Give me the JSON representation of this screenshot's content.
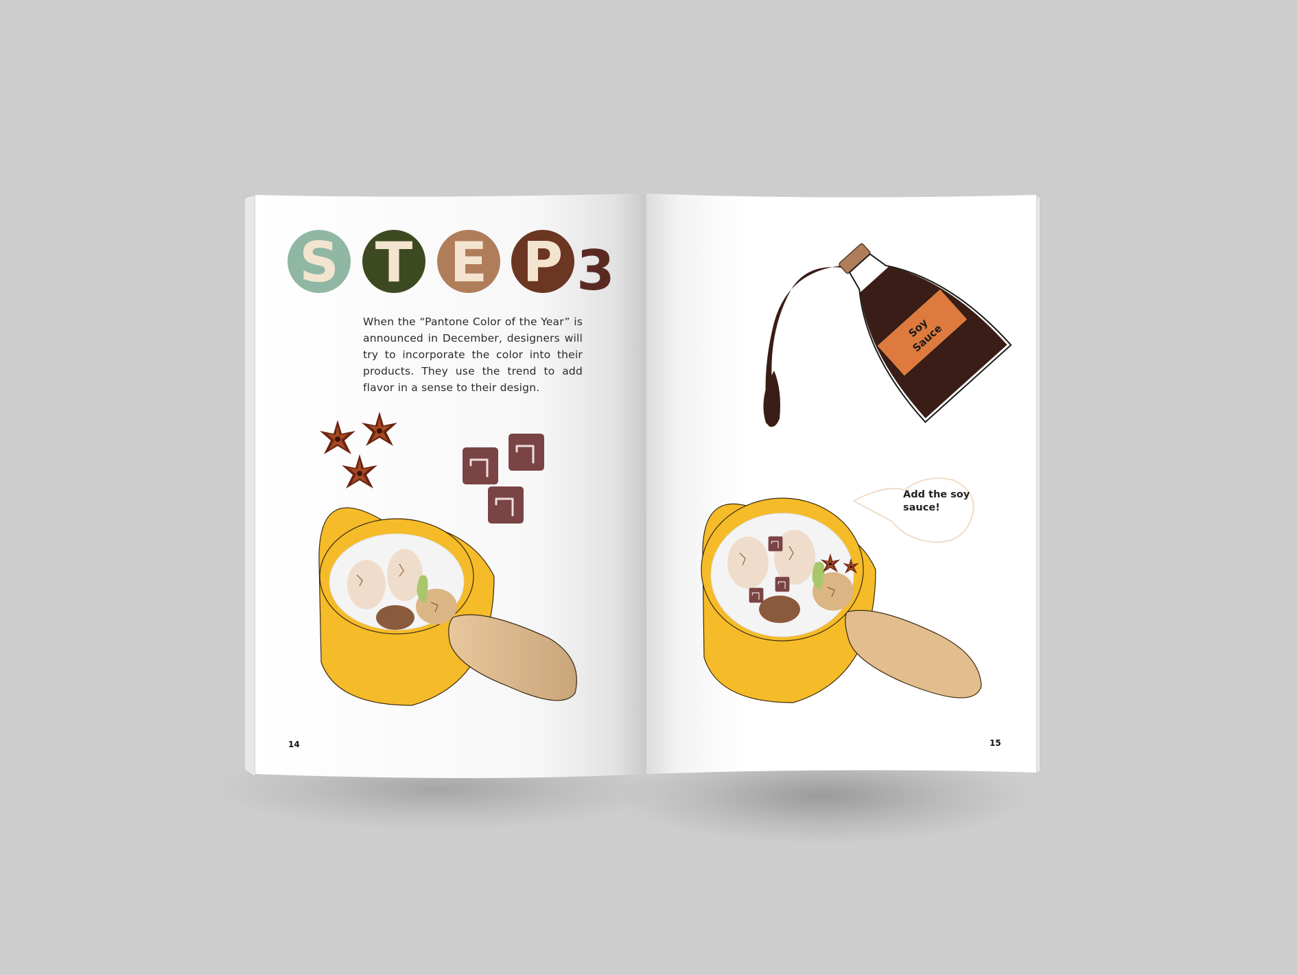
{
  "spread": {
    "left_page": {
      "heading_letters": [
        "S",
        "T",
        "E",
        "P",
        "3"
      ],
      "paragraph": "When the “Pantone Color of the Year” is announced in December, designers will try to incorporate the color into their products. They use the trend to add flavor in a sense to their design.",
      "page_number": "14"
    },
    "right_page": {
      "bottle_label_line1": "Soy",
      "bottle_label_line2": "Sauce",
      "speech_bubble": "Add the soy sauce!",
      "page_number": "15"
    }
  },
  "colors": {
    "background": "#cdcdcd",
    "circle_s": "#8fb7a4",
    "circle_t": "#3d4a21",
    "circle_e": "#b07d5b",
    "circle_p": "#6b3622",
    "digit_3": "#5a2a22",
    "letter_fill": "#f3e4cf",
    "pot_yellow": "#f5bb28",
    "handle_tan": "#e2bd8d",
    "soy_brown": "#3a1d16",
    "label_orange": "#de7a3e",
    "star_anise": "#6a2512",
    "tofu_cube": "#7a4445"
  }
}
